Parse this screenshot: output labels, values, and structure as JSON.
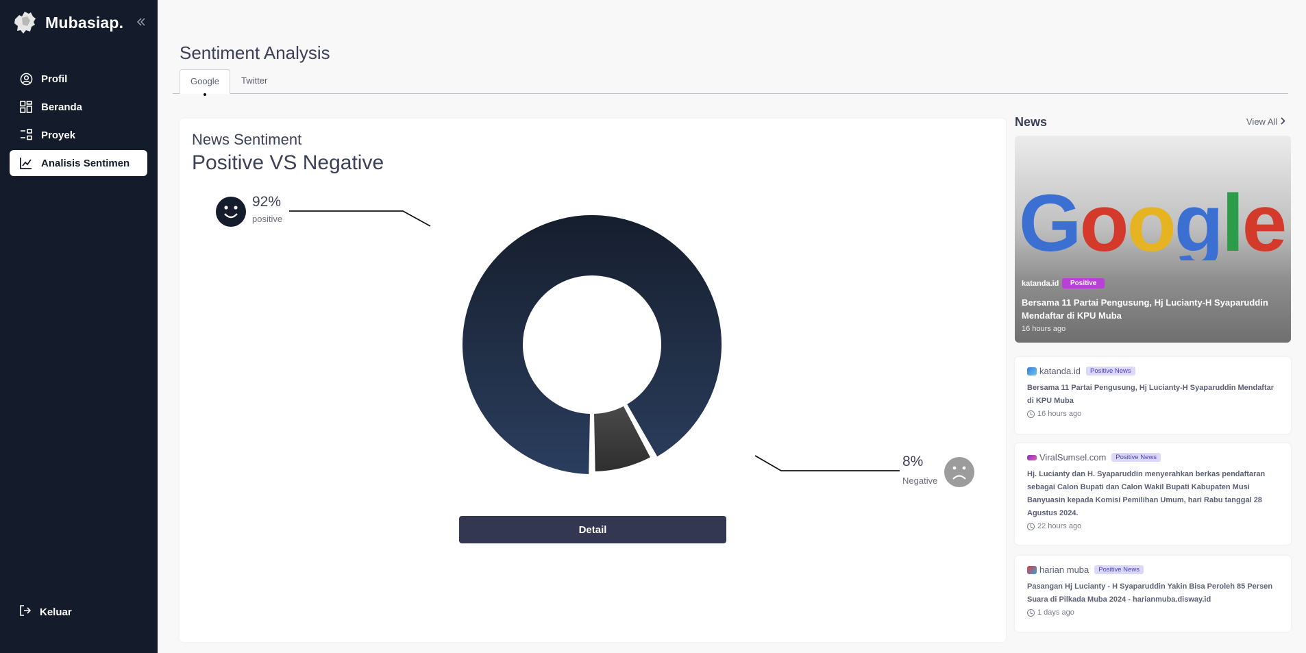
{
  "brand": {
    "name": "Mubasiap."
  },
  "sidebar": {
    "items": [
      {
        "label": "Profil",
        "icon": "user-circle-icon"
      },
      {
        "label": "Beranda",
        "icon": "grid-icon"
      },
      {
        "label": "Proyek",
        "icon": "tasks-icon"
      },
      {
        "label": "Analisis Sentimen",
        "icon": "chart-line-icon",
        "active": true
      }
    ],
    "logout": "Keluar"
  },
  "page": {
    "title": "Sentiment Analysis",
    "tabs": [
      {
        "label": "Google",
        "active": true
      },
      {
        "label": "Twitter",
        "active": false
      }
    ]
  },
  "card": {
    "subtitle": "News Sentiment",
    "title": "Positive VS Negative",
    "positive_pct": "92%",
    "positive_label": "positive",
    "negative_pct": "8%",
    "negative_label": "Negative",
    "detail_button": "Detail"
  },
  "chart_data": {
    "type": "pie",
    "categories": [
      "positive",
      "Negative"
    ],
    "values": [
      92,
      8
    ],
    "colors": [
      "#1f2c45",
      "#3d3d3d"
    ]
  },
  "news": {
    "heading": "News",
    "view_all": "View All",
    "hero": {
      "source": "katanda.id",
      "badge": "Positive",
      "title": "Bersama 11 Partai Pengusung, Hj Lucianty-H Syaparuddin Mendaftar di KPU Muba",
      "time": "16 hours ago",
      "image": "Google"
    },
    "items": [
      {
        "source": "katanda.id",
        "badge": "Positive News",
        "text": "Bersama 11 Partai Pengusung, Hj Lucianty-H Syaparuddin Mendaftar di KPU Muba",
        "time": "16 hours ago"
      },
      {
        "source": "ViralSumsel.com",
        "badge": "Positive News",
        "text": "Hj. Lucianty dan H. Syaparuddin menyerahkan berkas pendaftaran sebagai Calon Bupati dan Calon Wakil Bupati Kabupaten Musi Banyuasin kepada Komisi Pemilihan Umum, hari Rabu tanggal 28 Agustus 2024.",
        "time": "22 hours ago"
      },
      {
        "source": "harian muba",
        "badge": "Positive News",
        "text": "Pasangan Hj Lucianty - H Syaparuddin Yakin Bisa Peroleh 85 Persen Suara di Pilkada Muba 2024 - harianmuba.disway.id",
        "time": "1 days ago"
      }
    ]
  }
}
